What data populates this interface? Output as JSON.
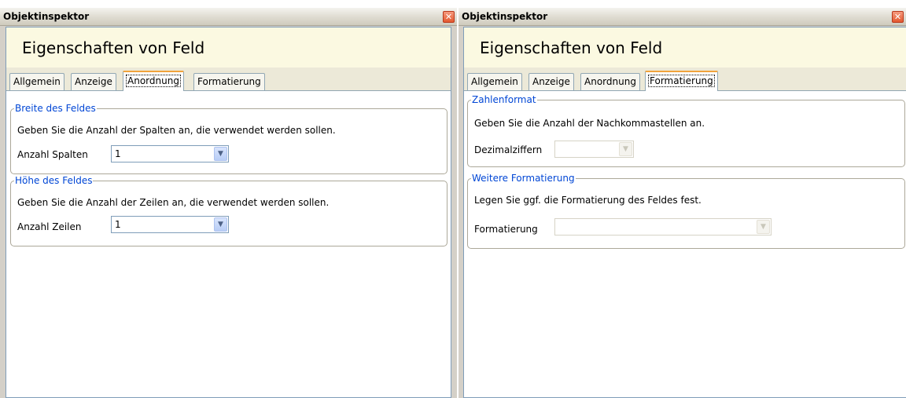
{
  "panels": {
    "left": {
      "title": "Objektinspektor",
      "close_glyph": "✕",
      "header": "Eigenschaften von Feld",
      "tabs": [
        "Allgemein",
        "Anzeige",
        "Anordnung",
        "Formatierung"
      ],
      "active_tab": "Anordnung",
      "groups": [
        {
          "legend": "Breite des Feldes",
          "description": "Geben Sie die Anzahl der Spalten an, die verwendet werden sollen.",
          "field_label": "Anzahl Spalten",
          "field_value": "1"
        },
        {
          "legend": "Höhe des Feldes",
          "description": "Geben Sie die Anzahl der Zeilen an, die verwendet werden sollen.",
          "field_label": "Anzahl Zeilen",
          "field_value": "1"
        }
      ]
    },
    "right": {
      "title": "Objektinspektor",
      "close_glyph": "✕",
      "header": "Eigenschaften von Feld",
      "tabs": [
        "Allgemein",
        "Anzeige",
        "Anordnung",
        "Formatierung"
      ],
      "active_tab": "Formatierung",
      "groups": [
        {
          "legend": "Zahlenformat",
          "description": "Geben Sie die Anzahl der Nachkommastellen an.",
          "field_label": "Dezimalziffern",
          "field_value": ""
        },
        {
          "legend": "Weitere Formatierung",
          "description": "Legen Sie ggf. die Formatierung des Feldes fest.",
          "field_label": "Formatierung",
          "field_value": ""
        }
      ]
    }
  },
  "icons": {
    "close": "close-icon",
    "dropdown": "chevron-down-icon"
  },
  "colors": {
    "header_bg": "#fbf9e1",
    "legend": "#0046d5",
    "active_tab_accent": "#f1a33c"
  }
}
